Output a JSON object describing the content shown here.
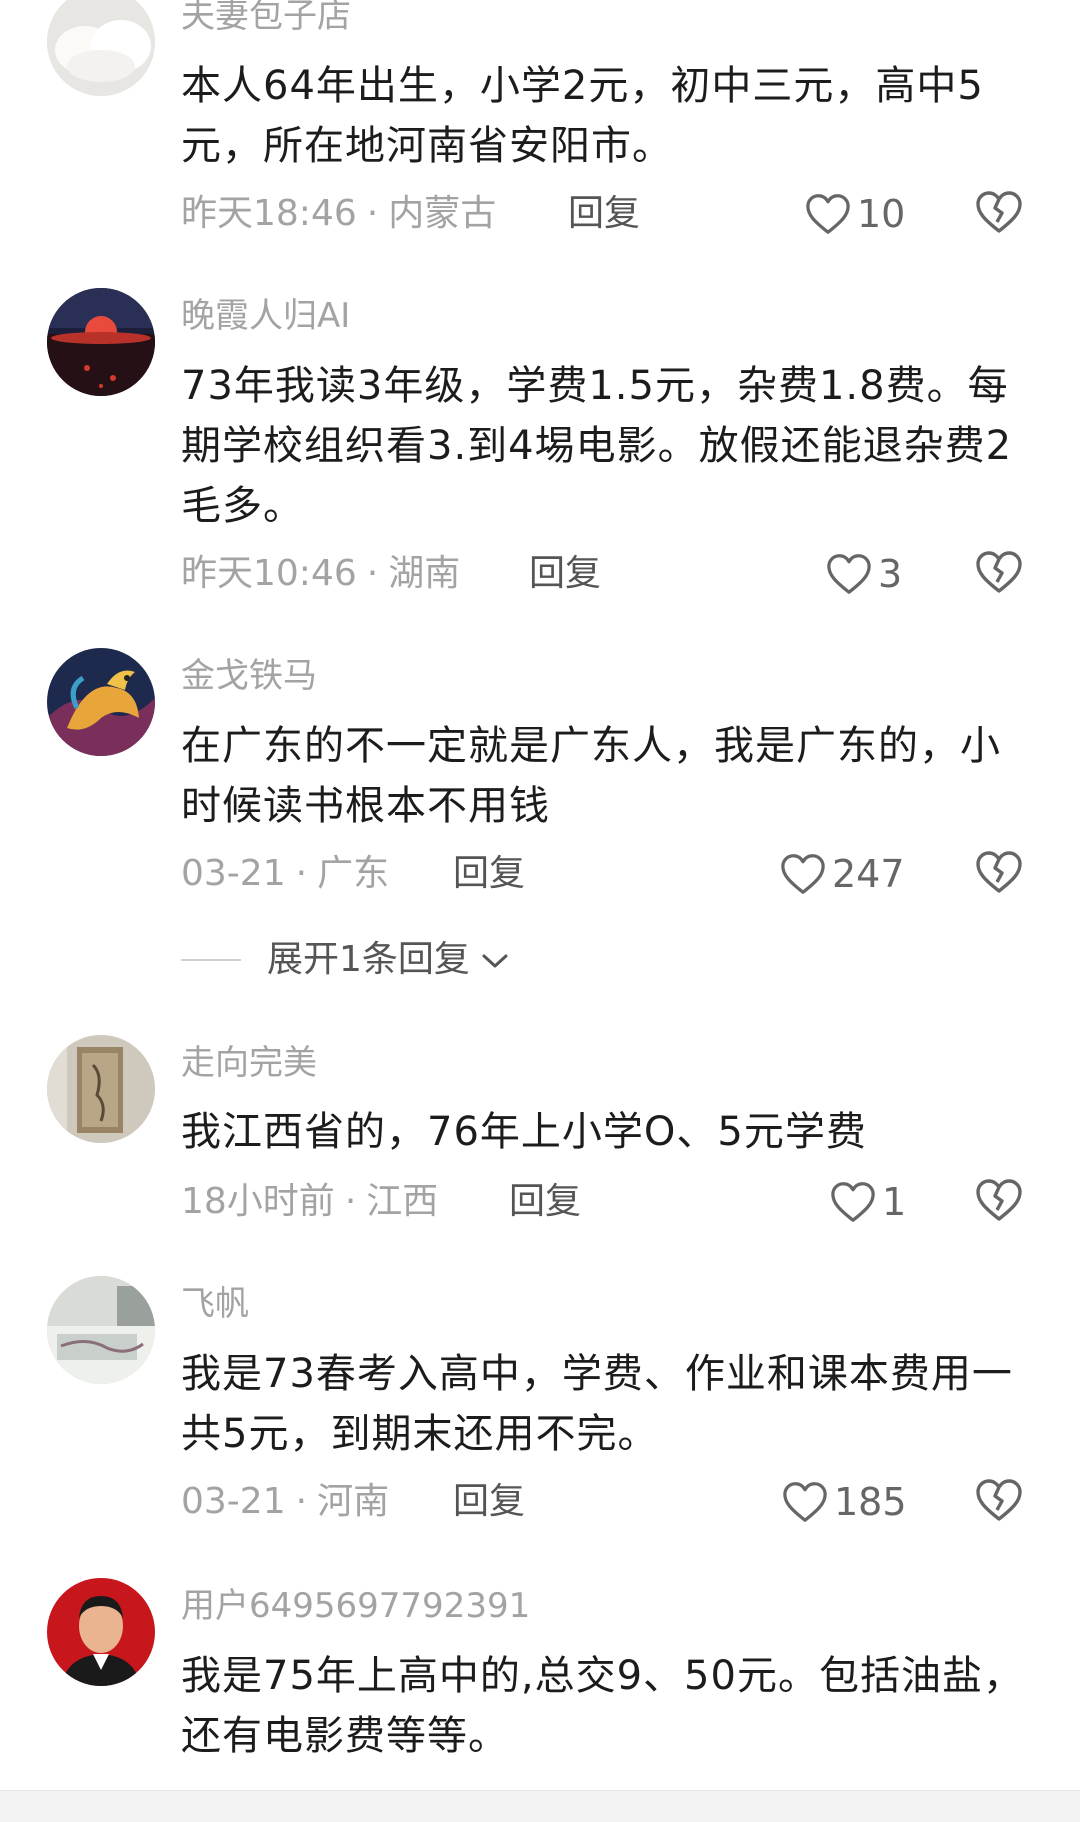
{
  "comments": [
    {
      "username": "夫妻包子店",
      "content": "本人64年出生，小学2元，初中三元，高中5元，所在地河南省安阳市。",
      "time": "昨天18:46",
      "location": "内蒙古",
      "reply": "回复",
      "likes": "10",
      "avatar": "buns-photo"
    },
    {
      "username": "晚霞人归AI",
      "content": "73年我读3年级，学费1.5元，杂费1.8费。每期学校组织看3.到4埸电影。放假还能退杂费2毛多。",
      "time": "昨天10:46",
      "location": "湖南",
      "reply": "回复",
      "likes": "3",
      "avatar": "sunset-photo"
    },
    {
      "username": "金戈铁马",
      "content": "在广东的不一定就是广东人，我是广东的，小时候读书根本不用钱",
      "time": "03-21",
      "location": "广东",
      "reply": "回复",
      "likes": "247",
      "avatar": "golden-horse",
      "expand": "展开1条回复"
    },
    {
      "username": "走向完美",
      "content": "我江西省的，76年上小学O、5元学费",
      "time": "18小时前",
      "location": "江西",
      "reply": "回复",
      "likes": "1",
      "avatar": "painting-photo"
    },
    {
      "username": "飞帆",
      "content": "我是73春考入高中，学费、作业和课本费用一共5元，到期末还用不完。",
      "time": "03-21",
      "location": "河南",
      "reply": "回复",
      "likes": "185",
      "avatar": "room-photo"
    },
    {
      "username": "用户6495697792391",
      "content": "我是75年上高中的,总交9、50元。包括油盐，还有电影费等等。",
      "avatar": "man-portrait"
    }
  ],
  "separator": "·",
  "icons": {
    "like": "heart-outline-icon",
    "dislike": "broken-heart-icon",
    "expand": "chevron-down-icon"
  },
  "colors": {
    "meta": "#a3a3a3",
    "text": "#1c1c1c"
  }
}
